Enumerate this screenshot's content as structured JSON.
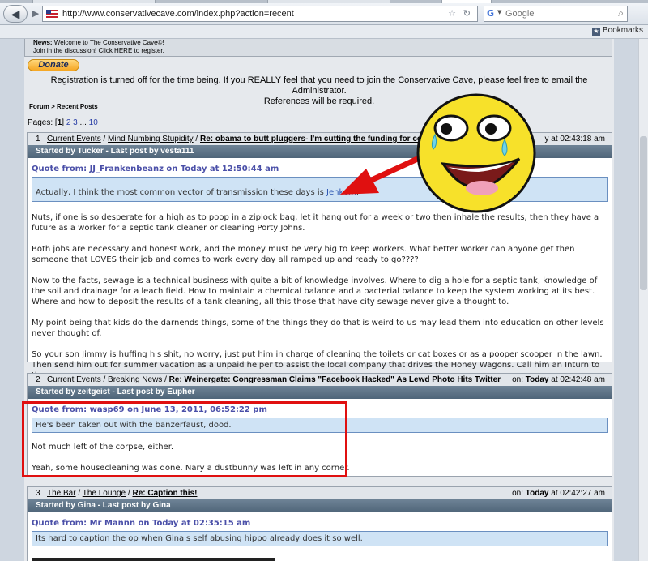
{
  "browser": {
    "url": "http://www.conservativecave.com/index.php?action=recent",
    "search_placeholder": "Google",
    "bookmarks_label": "Bookmarks"
  },
  "site": {
    "news_label": "News:",
    "news_text": " Welcome to The Conservative Cave©!",
    "join_text_1": "Join in the discussion!  Click ",
    "join_link": "HERE",
    "join_text_2": " to register.",
    "donate_label": "Donate",
    "notice_line1": "Registration is turned off for the time being. If you REALLY feel that you need to join the Conservative Cave, please feel free to email the Administrator.",
    "notice_line2": "References will be required.",
    "crumb": "Forum > Recent Posts",
    "pages_label": "Pages: ",
    "pages_current": "1",
    "pages_links": [
      "2",
      "3"
    ],
    "pages_ellipsis": " ... ",
    "pages_last": "10"
  },
  "posts": [
    {
      "num": "1",
      "board": "Current Events",
      "subboard": "Mind Numbing Stupidity",
      "title": "Re: obama to butt pluggers- I'm cutting the funding for co",
      "meta_time": "y at 02:43:18 am",
      "started": "Started by Tucker - Last post by vesta111",
      "quote_head": "Quote from: JJ_Frankenbeanz on Today at 12:50:44 am",
      "quote_text": "Actually, I think the most common vector of transmission these days is ",
      "quote_link": "Jenkem",
      "quote_end": ".",
      "paragraphs": [
        "Nuts, if one is so desperate for a high as to poop in a ziplock bag, let it hang out for a week or two then inhale the results, then they have a future as a worker for a septic tank cleaner or cleaning Porty Johns.",
        "Both jobs are necessary and honest work, and the money must be very big to keep workers. What better worker can anyone get then someone that LOVES their job and comes to work every day all ramped up and ready to go????",
        "Now to the facts, sewage is a technical business with quite a bit of knowledge involves.  Where to dig a hole for a septic tank, knowledge of the soil and drainage for a leach field.   How to maintain a chemical balance and a bacterial balance  to keep the system working at its best.   Where and how to deposit the results of a tank cleaning, all this those that have city sewage never give a thought to.",
        "My point being that kids do the darnends things, some of the things they do that is weird to us may lead them into education on other levels never thought of.",
        "So your son Jimmy is huffing his shit, no worry, just put him in charge of cleaning the toilets or cat boxes or as a pooper scooper in the lawn. Then send him out for summer vacation as a unpaid helper to assist the local company that drives the Honey Wagons.   Call him an Inturn to the company."
      ]
    },
    {
      "num": "2",
      "board": "Current Events",
      "subboard": "Breaking News",
      "title": "Re: Weinergate: Congressman Claims \"Facebook Hacked\" As Lewd Photo Hits Twitter",
      "meta_on": "on: ",
      "meta_today": "Today",
      "meta_time": " at 02:42:48 am",
      "started": "Started by zeitgeist - Last post by Eupher",
      "quote_head": "Quote from: wasp69 on June 13, 2011, 06:52:22 pm",
      "quote_text": "He's been taken out with the banzerfaust, dood.",
      "paragraphs": [
        "Not much left of the corpse, either.",
        "Yeah, some housecleaning was done. Nary a dustbunny was left in any corner."
      ]
    },
    {
      "num": "3",
      "board": "The Bar",
      "subboard": "The Lounge",
      "title": "Re: Caption this!",
      "meta_on": "on: ",
      "meta_today": "Today",
      "meta_time": " at 02:42:27 am",
      "started": "Started by Gina - Last post by Gina",
      "quote_head": "Quote from: Mr Mannn on Today at 02:35:15 am",
      "quote_text": "Its hard to caption the op when Gina's self abusing hippo already does it so well."
    }
  ],
  "colors": {
    "annotation_red": "#e01010",
    "smiley_yellow": "#f7e12a",
    "header_blue": "#4f6579",
    "quote_blue": "#cfe3f5"
  },
  "icons": [
    "back-arrow-icon",
    "forward-arrow-icon",
    "star-icon",
    "reload-icon",
    "google-icon",
    "search-icon",
    "bookmarks-icon",
    "awesome-smiley-icon"
  ]
}
